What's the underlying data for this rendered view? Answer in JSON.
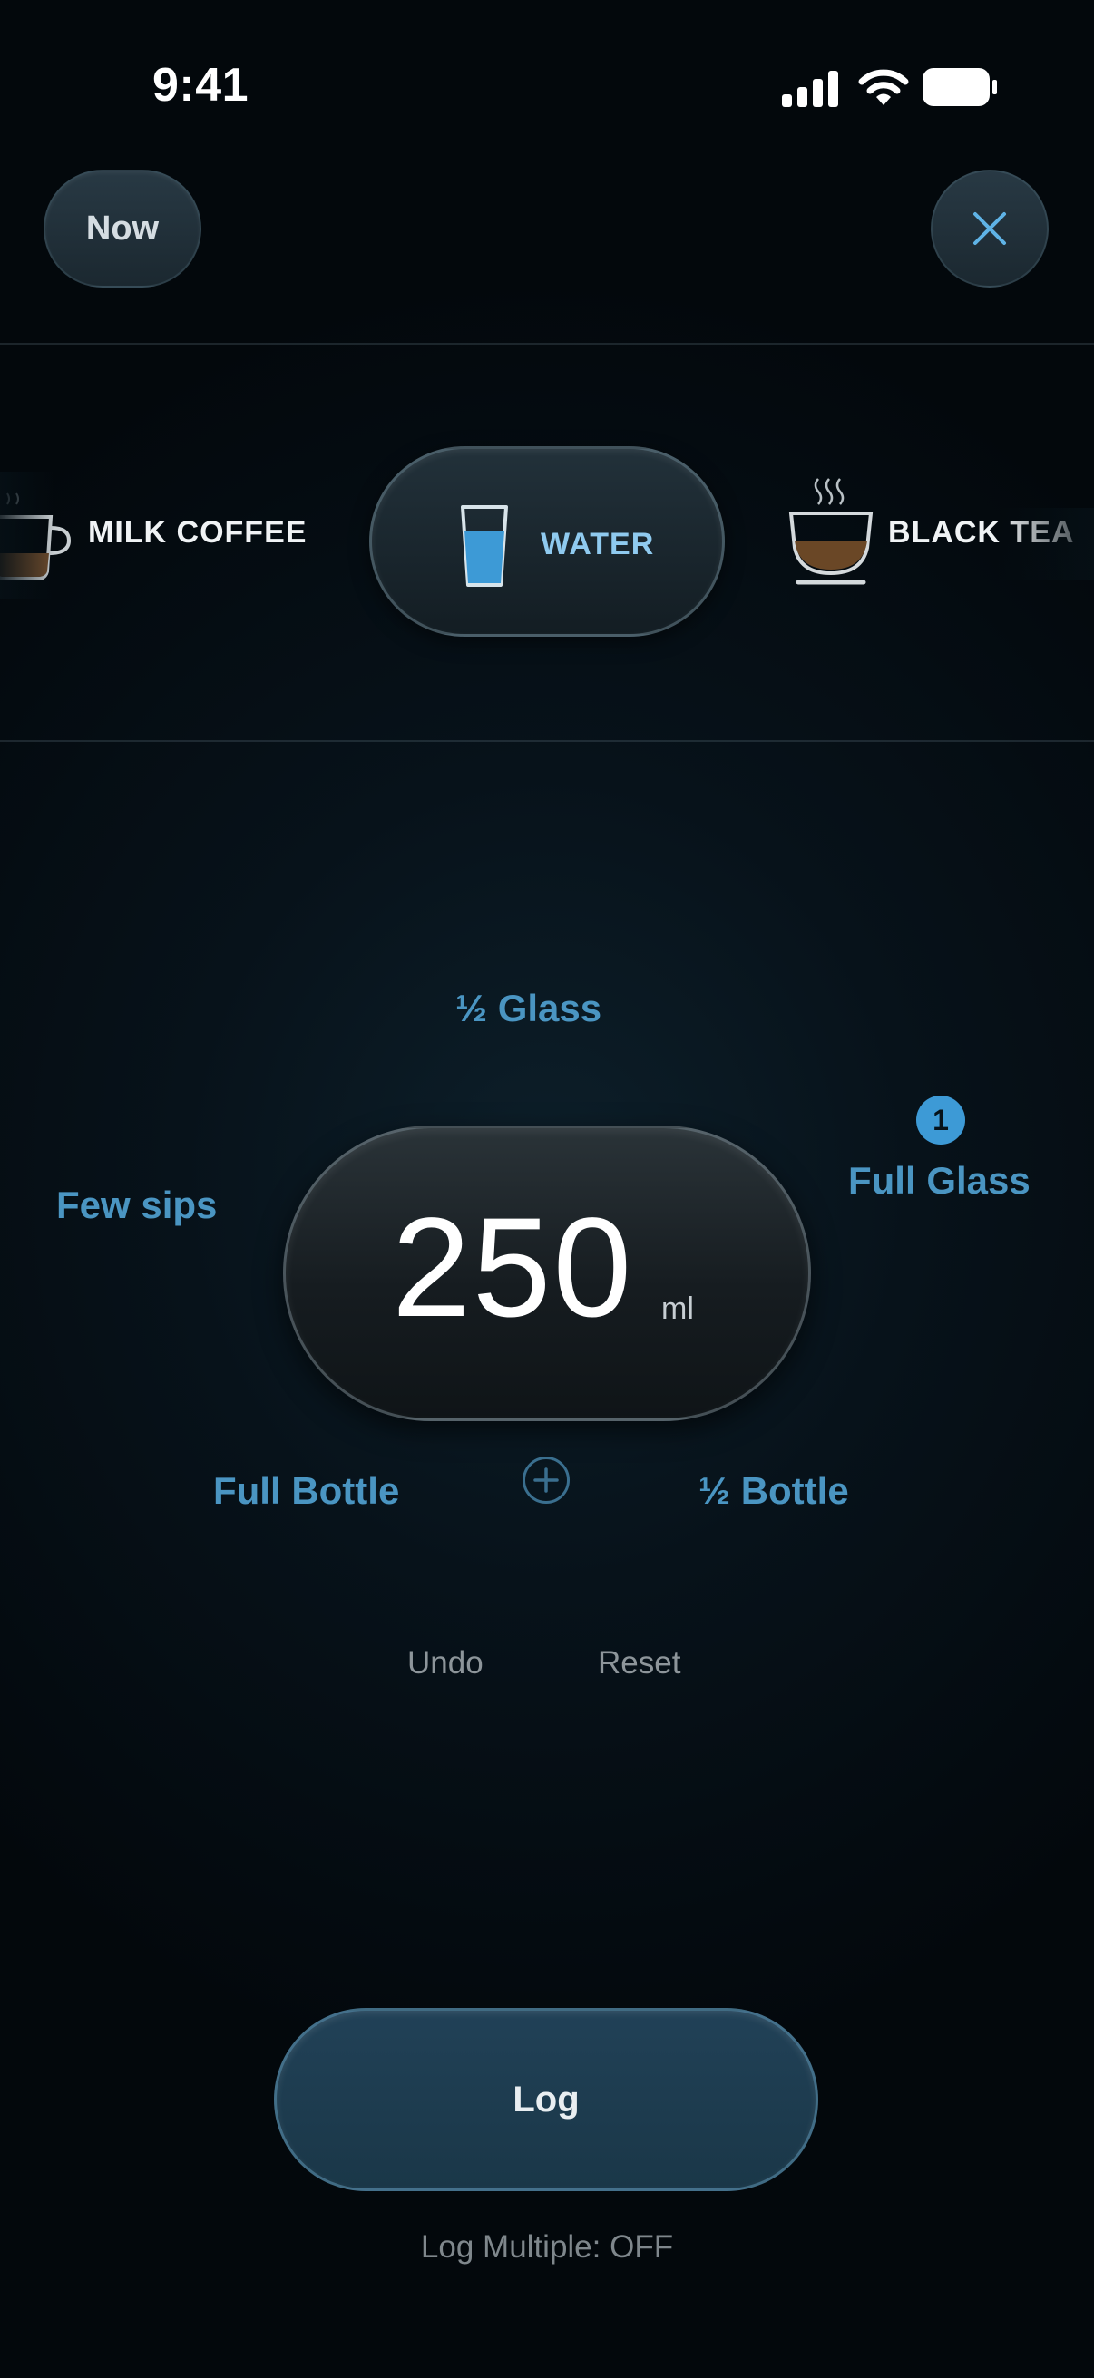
{
  "status_bar": {
    "time": "9:41"
  },
  "header": {
    "now_label": "Now",
    "close_icon": "close-icon"
  },
  "drink_selector": {
    "items": [
      {
        "label": "MILK COFFEE",
        "icon": "milk-coffee-cup-icon",
        "selected": false
      },
      {
        "label": "WATER",
        "icon": "water-glass-icon",
        "selected": true
      },
      {
        "label": "BLACK TEA",
        "icon": "black-tea-cup-icon",
        "selected": false
      }
    ]
  },
  "presets": {
    "half_glass": "½ Glass",
    "few_sips": "Few sips",
    "full_glass": "Full Glass",
    "full_glass_count": "1",
    "full_bottle": "Full Bottle",
    "half_bottle": "½ Bottle"
  },
  "amount": {
    "value": "250",
    "unit": "ml"
  },
  "actions": {
    "add_icon": "plus-circle-icon",
    "undo": "Undo",
    "reset": "Reset"
  },
  "footer": {
    "log_label": "Log",
    "log_multiple": "Log Multiple: OFF"
  },
  "colors": {
    "accent": "#4a95c2",
    "badge": "#3d9ad6",
    "water": "#3d9ad6",
    "log_button": "#1f3e52"
  }
}
